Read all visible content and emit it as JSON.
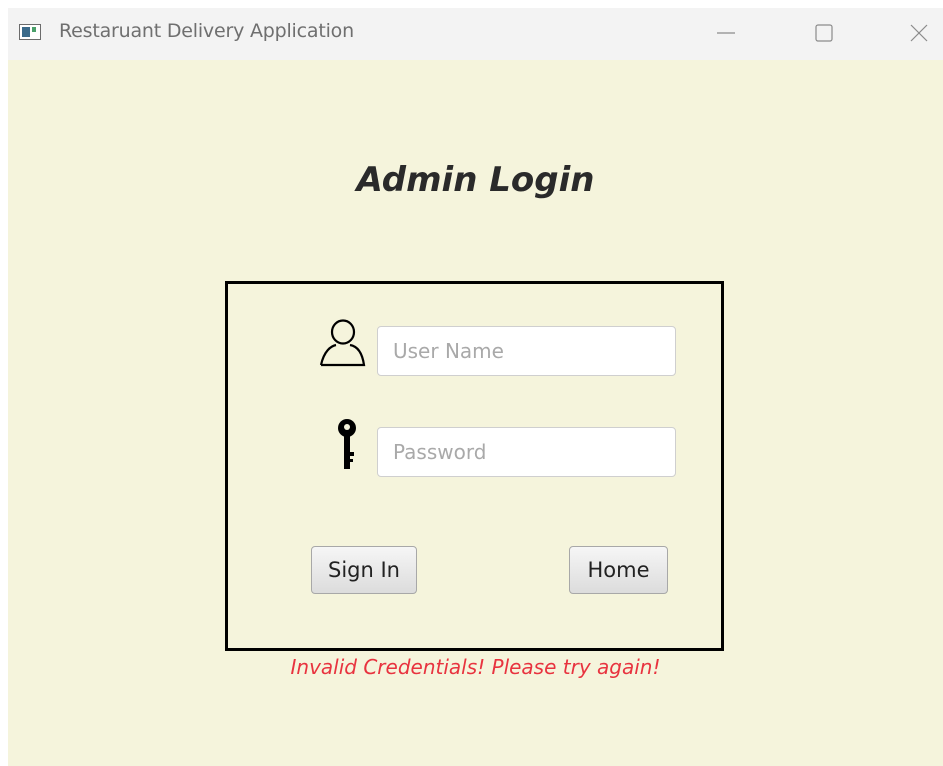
{
  "window": {
    "title": "Restaruant Delivery Application",
    "app_icon": "application-icon",
    "controls": {
      "minimize_icon": "minimize-icon",
      "maximize_icon": "maximize-icon",
      "close_icon": "close-icon"
    }
  },
  "login": {
    "heading": "Admin Login",
    "username": {
      "placeholder": "User Name",
      "value": "",
      "icon": "user-icon"
    },
    "password": {
      "placeholder": "Password",
      "value": "",
      "icon": "key-icon"
    },
    "sign_in_label": "Sign In",
    "home_label": "Home",
    "error_message": "Invalid Credentials! Please try again!"
  },
  "colors": {
    "background": "#f5f4dc",
    "titlebar": "#f3f3f3",
    "error": "#e8333f",
    "box_border": "#000000"
  }
}
